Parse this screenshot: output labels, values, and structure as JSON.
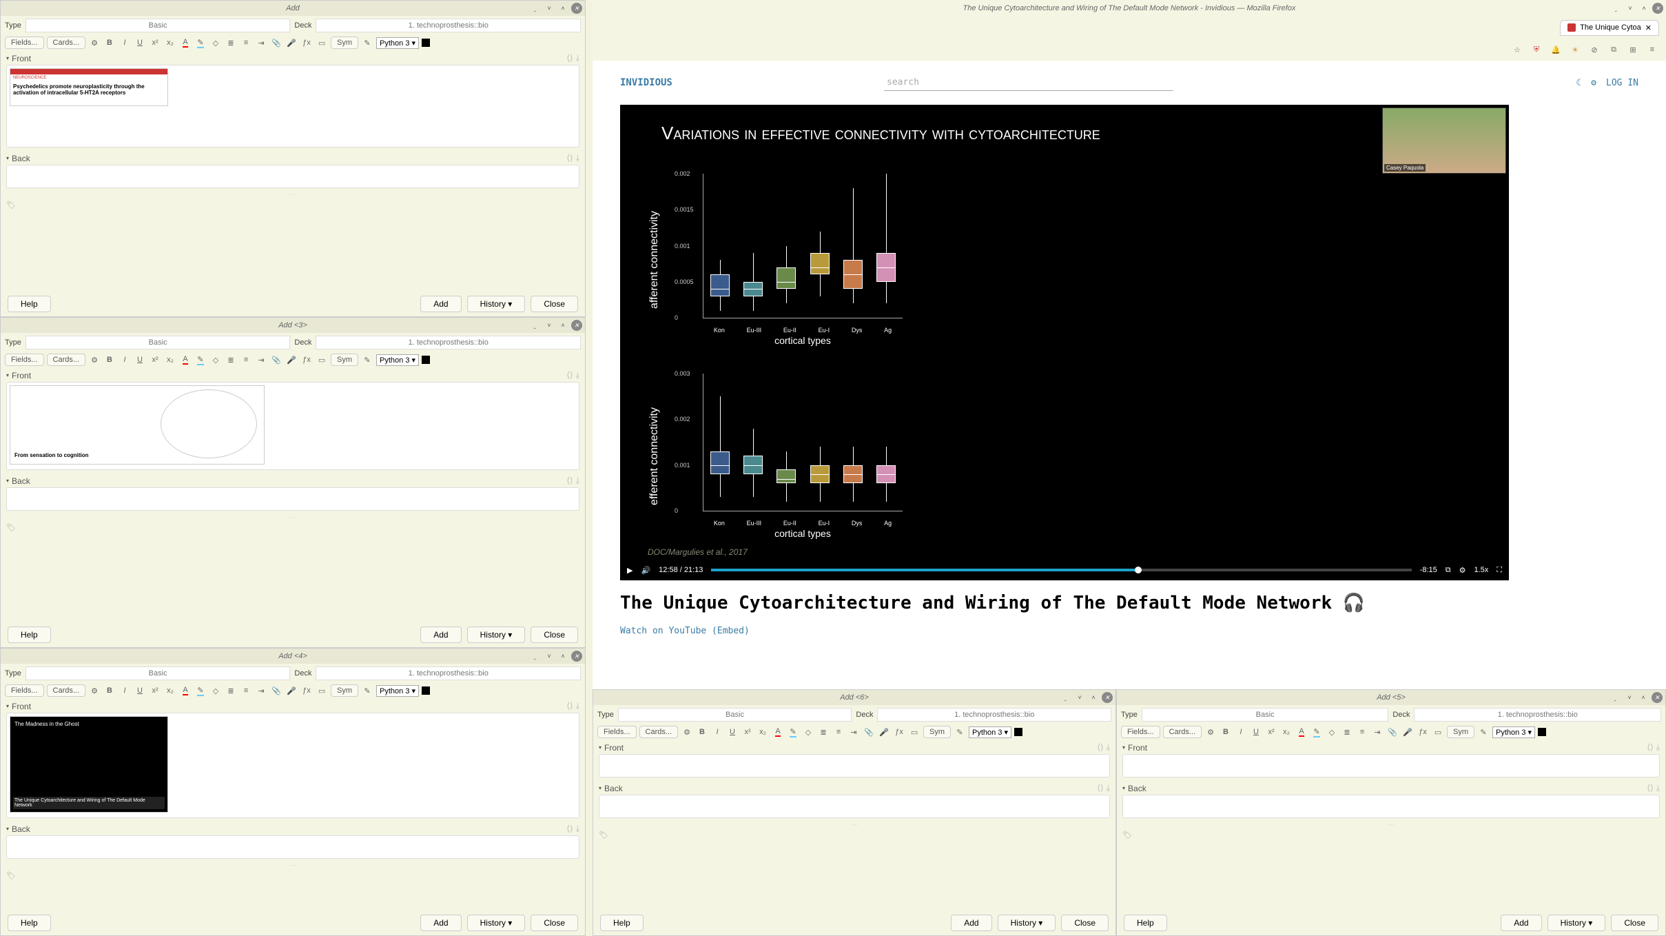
{
  "firefox": {
    "window_title": "The Unique Cytoarchitecture and Wiring of The Default Mode Network - Invidious — Mozilla Firefox",
    "tab_label": "The Unique Cytoa",
    "invidious": {
      "logo": "INVIDIOUS",
      "search_placeholder": "search",
      "login": "LOG IN",
      "video_title": "The Unique Cytoarchitecture and Wiring of The Default Mode Network 🎧",
      "watch_links": "Watch on YouTube (Embed)",
      "slide_title": "Variations in effective connectivity with cytoarchitecture",
      "citation": "DOC/Margulies et al., 2017",
      "pip_caption": "Casey Paquola",
      "time_elapsed": "12:58 / 21:13",
      "time_remaining": "-8:15",
      "speed": "1.5x"
    }
  },
  "anki_common": {
    "type_lbl": "Type",
    "deck_lbl": "Deck",
    "type_val": "Basic",
    "deck_val": "1. technoprosthesis::bio",
    "fields_btn": "Fields...",
    "cards_btn": "Cards...",
    "sym_btn": "Sym",
    "python_lang": "Python 3 ▾",
    "front_lbl": "Front",
    "back_lbl": "Back",
    "help_btn": "Help",
    "add_btn": "Add",
    "history_btn": "History ▾",
    "close_btn": "Close"
  },
  "panels": [
    {
      "title": "Add",
      "thumb_caption": "Psychedelics promote neuroplasticity through the activation of intracellular 5-HT2A receptors",
      "thumb_pre": "NEUROSCIENCE"
    },
    {
      "title": "Add <3>",
      "thumb_caption": "From sensation to cognition"
    },
    {
      "title": "Add <4>",
      "thumb_caption": "The Unique Cytoarchitecture and Wiring of The Default Mode Network",
      "thumb_pre": "The Madness in the Ghost"
    },
    {
      "title": "Add <6>"
    },
    {
      "title": "Add <5>"
    }
  ],
  "chart_data": [
    {
      "type": "box",
      "title": "afferent connectivity",
      "ylabel": "afferent connectivity",
      "xlabel": "cortical types",
      "categories": [
        "Kon",
        "Eu-III",
        "Eu-II",
        "Eu-I",
        "Dys",
        "Ag"
      ],
      "ylim": [
        0,
        0.002
      ],
      "yticks": [
        0.0,
        0.0005,
        0.001,
        0.0015,
        0.002
      ],
      "series": [
        {
          "name": "Kon",
          "q1": 0.0003,
          "median": 0.0004,
          "q3": 0.0006,
          "low": 0.0001,
          "high": 0.0008,
          "color": "#3b5b8c"
        },
        {
          "name": "Eu-III",
          "q1": 0.0003,
          "median": 0.0004,
          "q3": 0.0005,
          "low": 0.0001,
          "high": 0.0009,
          "color": "#4a8a8f"
        },
        {
          "name": "Eu-II",
          "q1": 0.0004,
          "median": 0.0005,
          "q3": 0.0007,
          "low": 0.0002,
          "high": 0.001,
          "color": "#6a8a4a"
        },
        {
          "name": "Eu-I",
          "q1": 0.0006,
          "median": 0.0007,
          "q3": 0.0009,
          "low": 0.0003,
          "high": 0.0012,
          "color": "#b89a3a"
        },
        {
          "name": "Dys",
          "q1": 0.0004,
          "median": 0.0006,
          "q3": 0.0008,
          "low": 0.0002,
          "high": 0.0018,
          "color": "#c77a4a"
        },
        {
          "name": "Ag",
          "q1": 0.0005,
          "median": 0.0007,
          "q3": 0.0009,
          "low": 0.0002,
          "high": 0.002,
          "color": "#d490b5"
        }
      ]
    },
    {
      "type": "box",
      "title": "efferent connectivity",
      "ylabel": "efferent connectivity",
      "xlabel": "cortical types",
      "categories": [
        "Kon",
        "Eu-III",
        "Eu-II",
        "Eu-I",
        "Dys",
        "Ag"
      ],
      "ylim": [
        0,
        0.003
      ],
      "yticks": [
        0.0,
        0.001,
        0.002,
        0.003
      ],
      "series": [
        {
          "name": "Kon",
          "q1": 0.0008,
          "median": 0.001,
          "q3": 0.0013,
          "low": 0.0003,
          "high": 0.0025,
          "color": "#3b5b8c"
        },
        {
          "name": "Eu-III",
          "q1": 0.0008,
          "median": 0.001,
          "q3": 0.0012,
          "low": 0.0003,
          "high": 0.0018,
          "color": "#4a8a8f"
        },
        {
          "name": "Eu-II",
          "q1": 0.0006,
          "median": 0.0007,
          "q3": 0.0009,
          "low": 0.0002,
          "high": 0.0013,
          "color": "#6a8a4a"
        },
        {
          "name": "Eu-I",
          "q1": 0.0006,
          "median": 0.0008,
          "q3": 0.001,
          "low": 0.0002,
          "high": 0.0014,
          "color": "#b89a3a"
        },
        {
          "name": "Dys",
          "q1": 0.0006,
          "median": 0.0008,
          "q3": 0.001,
          "low": 0.0002,
          "high": 0.0014,
          "color": "#c77a4a"
        },
        {
          "name": "Ag",
          "q1": 0.0006,
          "median": 0.0008,
          "q3": 0.001,
          "low": 0.0002,
          "high": 0.0014,
          "color": "#d490b5"
        }
      ]
    }
  ]
}
